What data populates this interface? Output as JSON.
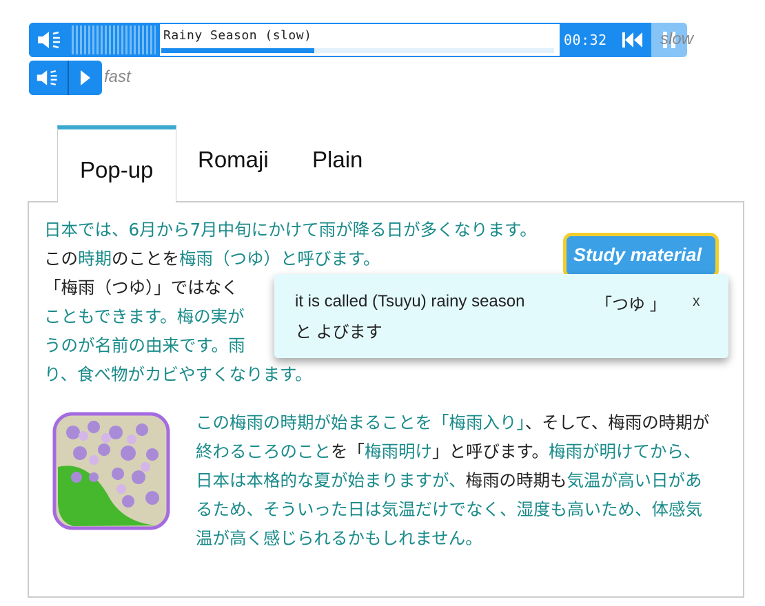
{
  "player_slow": {
    "title": "Rainy Season (slow)",
    "time": "00:32",
    "progress": 0.39,
    "speed_label": "slow"
  },
  "player_fast": {
    "speed_label": "fast"
  },
  "tabs": {
    "popup": "Pop-up",
    "romaji": "Romaji",
    "plain": "Plain"
  },
  "study_material": "Study material",
  "popup_box": {
    "english": "it is called (Tsuyu) rainy season",
    "japanese_1": "「つゆ 」",
    "japanese_2": "と よびます",
    "close": "x"
  },
  "paragraph1": {
    "s1": "日本では、6月から7月中旬にかけて雨が降る日が多くなります。",
    "s2a": "この",
    "s2b": "時期",
    "s2c": "のことを",
    "s2d": "梅雨（つゆ）と呼びます。",
    "s3a": "「梅雨（つゆ）」ではなく",
    "s4": "こともできます。",
    "s4b": "梅の実が",
    "s5": "うのが名前の由来です。",
    "s5b": "雨",
    "s6": "り、食べ物がカビやすくなります。"
  },
  "paragraph2": {
    "a": "この梅雨の時期が始まることを「梅雨入り」",
    "b": "、そして、梅雨の時期が",
    "c": "終わるころのこと",
    "d": "を「",
    "e": "梅雨明け",
    "f": "」と呼びます。",
    "g": "梅雨が明けてから、",
    "h": "日本は本格的な夏が始まりますが、",
    "i": "梅雨の時期も",
    "j": "気温が高い日があるため、",
    "k": "そういった日は気温だけでなく、",
    "l": "湿度も高いため、",
    "m": "体感気温が高く感じられるかもしれません。"
  }
}
